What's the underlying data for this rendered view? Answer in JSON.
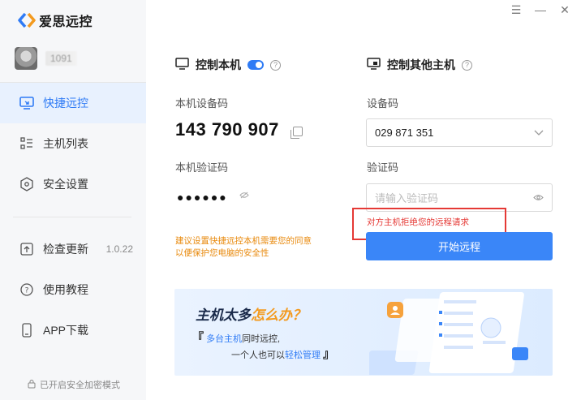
{
  "app": {
    "name": "爱思远控"
  },
  "user": {
    "name": "1091"
  },
  "window": {
    "menu": "☰",
    "minimize": "—",
    "close": "✕"
  },
  "sidebar": {
    "items": [
      {
        "label": "快捷远控",
        "icon": "remote-screen-icon"
      },
      {
        "label": "主机列表",
        "icon": "list-icon"
      },
      {
        "label": "安全设置",
        "icon": "shield-icon"
      },
      {
        "label": "检查更新",
        "icon": "upload-icon",
        "version": "1.0.22"
      },
      {
        "label": "使用教程",
        "icon": "help-circle-icon"
      },
      {
        "label": "APP下载",
        "icon": "phone-icon"
      }
    ],
    "footer": "已开启安全加密模式"
  },
  "local": {
    "title": "控制本机",
    "help": "?",
    "device_label": "本机设备码",
    "device_code": "143 790 907",
    "pwd_label": "本机验证码",
    "pwd_masked": "●●●●●●",
    "tip_line1": "建议设置快捷远控本机需要您的同意",
    "tip_line2": "以便保护您电脑的安全性"
  },
  "remote": {
    "title": "控制其他主机",
    "help": "?",
    "device_label": "设备码",
    "device_value": "029 871 351",
    "pwd_label": "验证码",
    "pwd_placeholder": "请输入验证码",
    "error": "对方主机拒绝您的远程请求",
    "start_button": "开始远程"
  },
  "banner": {
    "title_a": "主机太多",
    "title_b": "怎么办？",
    "line1_a": "多台主机",
    "line1_b": "同时远控,",
    "line2_a": "一个人也可以",
    "line2_b": "轻松管理"
  },
  "colors": {
    "accent": "#2f7bf5",
    "warning": "#e8890c",
    "error": "#e53935"
  }
}
